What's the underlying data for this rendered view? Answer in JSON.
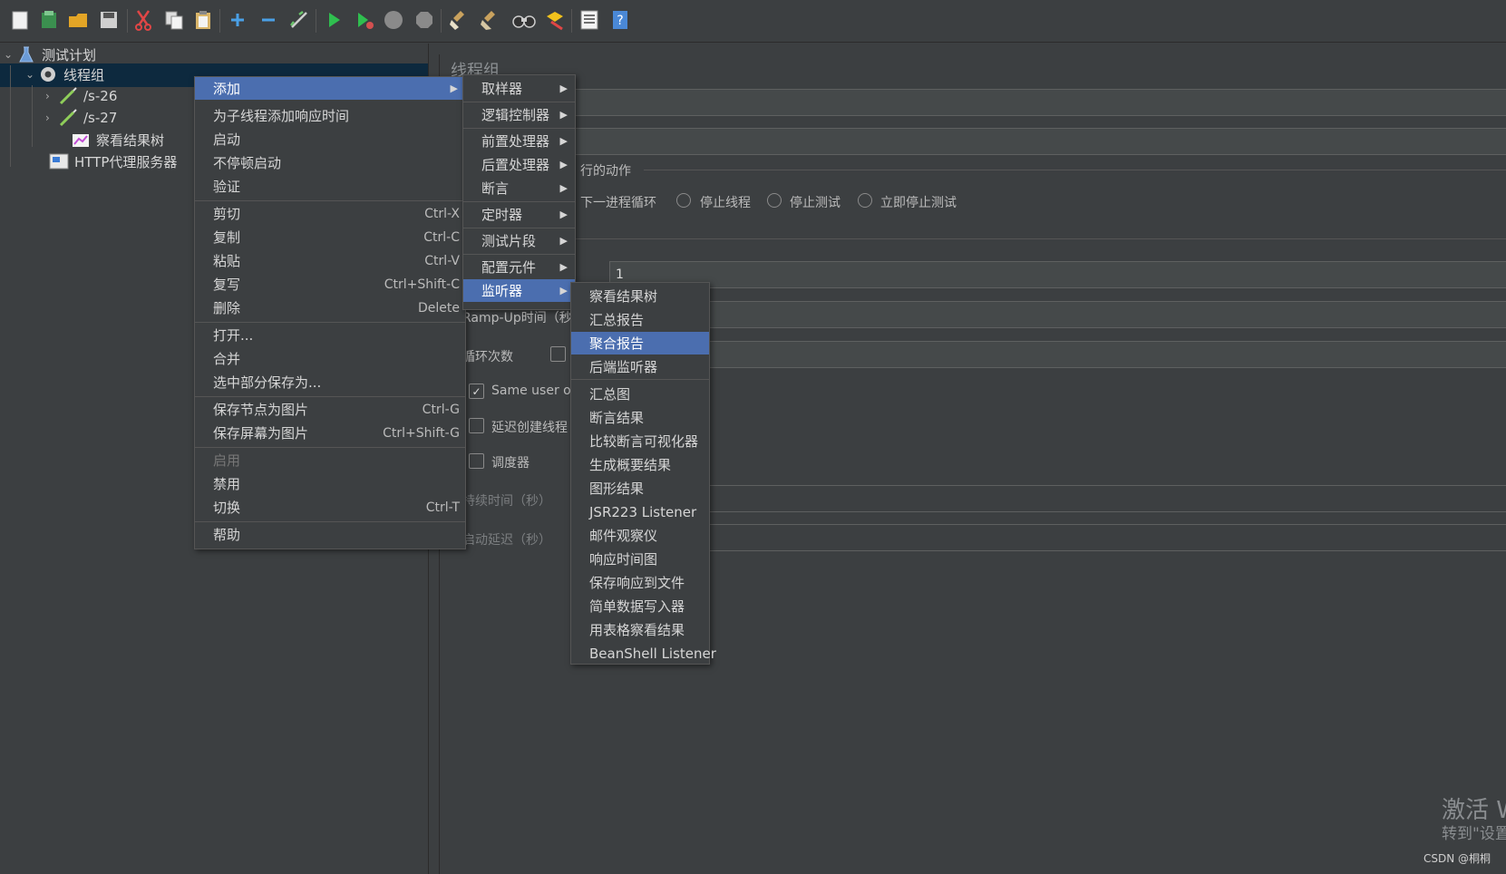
{
  "toolbar": {
    "icons": [
      "new-icon",
      "templates-icon",
      "open-icon",
      "save-icon",
      "cut-icon",
      "copy-icon",
      "paste-icon",
      "expand-icon",
      "collapse-icon",
      "toggle-icon",
      "start-icon",
      "start-no-pause-icon",
      "stop-icon",
      "shutdown-icon",
      "clear-icon",
      "clear-all-icon",
      "search-icon",
      "reset-search-icon",
      "function-helper-icon",
      "help-icon"
    ]
  },
  "tree": {
    "items": [
      {
        "label": "测试计划"
      },
      {
        "label": "线程组"
      },
      {
        "label": "/s-26"
      },
      {
        "label": "/s-27"
      },
      {
        "label": "察看结果树"
      },
      {
        "label": "HTTP代理服务器"
      }
    ]
  },
  "panel": {
    "title": "线程组",
    "action_label": "行的动作",
    "radio_next_loop": "下一进程循环",
    "radio_stop_thread": "停止线程",
    "radio_stop_test": "停止测试",
    "radio_stop_now": "立即停止测试",
    "threads_value": "1",
    "ramp_up_label": "Ramp-Up时间（秒",
    "loop_label": "循环次数",
    "same_user_label": "Same user on",
    "delay_create_label": "延迟创建线程",
    "scheduler_label": "调度器",
    "duration_label": "持续时间（秒）",
    "startup_delay_label": "启动延迟（秒）"
  },
  "context_menu": {
    "items": [
      {
        "label": "添加",
        "shortcut": ""
      },
      {
        "label": "为子线程添加响应时间",
        "shortcut": ""
      },
      {
        "label": "启动",
        "shortcut": ""
      },
      {
        "label": "不停顿启动",
        "shortcut": ""
      },
      {
        "label": "验证",
        "shortcut": ""
      },
      {
        "label": "剪切",
        "shortcut": "Ctrl-X"
      },
      {
        "label": "复制",
        "shortcut": "Ctrl-C"
      },
      {
        "label": "粘贴",
        "shortcut": "Ctrl-V"
      },
      {
        "label": "复写",
        "shortcut": "Ctrl+Shift-C"
      },
      {
        "label": "删除",
        "shortcut": "Delete"
      },
      {
        "label": "打开...",
        "shortcut": ""
      },
      {
        "label": "合并",
        "shortcut": ""
      },
      {
        "label": "选中部分保存为...",
        "shortcut": ""
      },
      {
        "label": "保存节点为图片",
        "shortcut": "Ctrl-G"
      },
      {
        "label": "保存屏幕为图片",
        "shortcut": "Ctrl+Shift-G"
      },
      {
        "label": "启用",
        "shortcut": ""
      },
      {
        "label": "禁用",
        "shortcut": ""
      },
      {
        "label": "切换",
        "shortcut": "Ctrl-T"
      },
      {
        "label": "帮助",
        "shortcut": ""
      }
    ]
  },
  "add_menu": {
    "items": [
      {
        "label": "取样器"
      },
      {
        "label": "逻辑控制器"
      },
      {
        "label": "前置处理器"
      },
      {
        "label": "后置处理器"
      },
      {
        "label": "断言"
      },
      {
        "label": "定时器"
      },
      {
        "label": "测试片段"
      },
      {
        "label": "配置元件"
      },
      {
        "label": "监听器"
      }
    ]
  },
  "listener_menu": {
    "items": [
      {
        "label": "察看结果树"
      },
      {
        "label": "汇总报告"
      },
      {
        "label": "聚合报告"
      },
      {
        "label": "后端监听器"
      },
      {
        "label": "汇总图"
      },
      {
        "label": "断言结果"
      },
      {
        "label": "比较断言可视化器"
      },
      {
        "label": "生成概要结果"
      },
      {
        "label": "图形结果"
      },
      {
        "label": "JSR223 Listener"
      },
      {
        "label": "邮件观察仪"
      },
      {
        "label": "响应时间图"
      },
      {
        "label": "保存响应到文件"
      },
      {
        "label": "简单数据写入器"
      },
      {
        "label": "用表格察看结果"
      },
      {
        "label": "BeanShell Listener"
      }
    ]
  },
  "watermark": {
    "line1": "激活 W",
    "line2": "转到\"设置",
    "credit": "CSDN @桐桐"
  },
  "colors": {
    "background": "#3c3f41",
    "selection": "#4b6eaf",
    "tree_selection": "#0d293e"
  }
}
